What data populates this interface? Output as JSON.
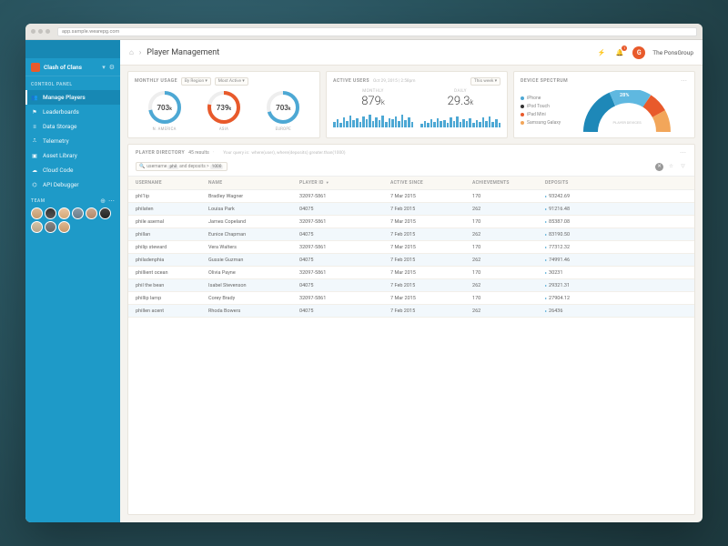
{
  "chrome": {
    "url": "app.sample.wearepg.com"
  },
  "sidebar": {
    "app_name": "Clash of Clans",
    "section_panel": "CONTROL PANEL",
    "section_team": "TEAM",
    "nav": [
      {
        "label": "Manage Players",
        "icon": "users",
        "active": true
      },
      {
        "label": "Leaderboards",
        "icon": "flag"
      },
      {
        "label": "Data Storage",
        "icon": "layers"
      },
      {
        "label": "Telemetry",
        "icon": "equalizer"
      },
      {
        "label": "Asset Library",
        "icon": "folder"
      },
      {
        "label": "Cloud Code",
        "icon": "cloud"
      },
      {
        "label": "API Debugger",
        "icon": "bug"
      }
    ]
  },
  "header": {
    "title": "Player Management",
    "user": "The PonsGroup",
    "notifications": "1"
  },
  "usage": {
    "title": "MONTHLY USAGE",
    "filter1": "By Region",
    "filter2": "Most Active",
    "donuts": [
      {
        "value": "703",
        "unit": "k",
        "label": "N. AMERICA",
        "pct": 72,
        "color": "#4da8d4"
      },
      {
        "value": "739",
        "unit": "k",
        "label": "ASIA",
        "pct": 78,
        "color": "#e85a2b"
      },
      {
        "value": "703",
        "unit": "k",
        "label": "EUROPE",
        "pct": 70,
        "color": "#4da8d4"
      }
    ]
  },
  "active": {
    "title": "ACTIVE USERS",
    "meta": "Oct 29, 2015 | 2:58pm",
    "filter": "This week",
    "metrics": [
      {
        "label": "MONTHLY",
        "value": "879",
        "unit": "k"
      },
      {
        "label": "DAILY",
        "value": "29.3",
        "unit": "k"
      }
    ],
    "bars1": [
      6,
      9,
      5,
      11,
      7,
      13,
      8,
      10,
      6,
      12,
      9,
      14,
      7,
      11,
      8,
      13,
      6,
      10,
      9,
      12,
      7,
      14,
      8,
      11,
      6
    ],
    "bars2": [
      4,
      7,
      5,
      9,
      6,
      10,
      7,
      8,
      5,
      11,
      7,
      12,
      6,
      9,
      7,
      10,
      5,
      8,
      6,
      11,
      7,
      12,
      6,
      9,
      5
    ]
  },
  "spectrum": {
    "title": "DEVICE SPECTRUM",
    "legend": [
      {
        "label": "iPhone",
        "color": "#4da8d4"
      },
      {
        "label": "iPod Touch",
        "color": "#333"
      },
      {
        "label": "iPad Mini",
        "color": "#e85a2b"
      },
      {
        "label": "Samsung Galaxy",
        "color": "#f2a65a"
      }
    ],
    "slices": [
      {
        "pct": "58%",
        "color": "#1e88b8"
      },
      {
        "pct": "28%",
        "color": "#5fb8e0"
      },
      {
        "pct": "12%",
        "color": "#e85a2b"
      },
      {
        "pct": "16%",
        "color": "#f2a65a"
      }
    ],
    "center": "PLAYER DEVICES"
  },
  "directory": {
    "title": "PLAYER DIRECTORY",
    "count": "45 results",
    "query_prefix": "Your query is:",
    "query": "where(user), where(deposits) greater.than(1000)",
    "search_prefix": "username",
    "chip1": "phil",
    "search_mid": "and deposits >",
    "chip2": "1000",
    "columns": [
      "USERNAME",
      "NAME",
      "PLAYER ID",
      "ACTIVE SINCE",
      "ACHIEVEMENTS",
      "DEPOSITS"
    ],
    "rows": [
      {
        "u": "phI1ip",
        "n": "Bradley Wagner",
        "p": "32097-5861",
        "a": "7 Mar 2015",
        "c": "170",
        "d": "93242.69"
      },
      {
        "u": "philaten",
        "n": "Louisa Park",
        "p": "04075",
        "a": "7 Feb 2015",
        "c": "262",
        "d": "91216.48"
      },
      {
        "u": "phile asernal",
        "n": "James Copeland",
        "p": "32097-5861",
        "a": "7 Mar 2015",
        "c": "170",
        "d": "85387.08"
      },
      {
        "u": "phillan",
        "n": "Eunice Chapman",
        "p": "04075",
        "a": "7 Feb 2015",
        "c": "262",
        "d": "83190.50"
      },
      {
        "u": "philip steward",
        "n": "Vera Walters",
        "p": "32097-5861",
        "a": "7 Mar 2015",
        "c": "170",
        "d": "77312.32"
      },
      {
        "u": "philadenphia",
        "n": "Gussie Guzman",
        "p": "04075",
        "a": "7 Feb 2015",
        "c": "262",
        "d": "74991.46"
      },
      {
        "u": "phillient ocean",
        "n": "Olivia Payne",
        "p": "32097-5861",
        "a": "7 Mar 2015",
        "c": "170",
        "d": "30231"
      },
      {
        "u": "phil the bean",
        "n": "Isabel Stevenson",
        "p": "04075",
        "a": "7 Feb 2015",
        "c": "262",
        "d": "29321.31"
      },
      {
        "u": "phillip lamp",
        "n": "Corey Brady",
        "p": "32097-5861",
        "a": "7 Mar 2015",
        "c": "170",
        "d": "27904.12"
      },
      {
        "u": "phillen acent",
        "n": "Rhoda Bowers",
        "p": "04075",
        "a": "7 Feb 2015",
        "c": "262",
        "d": "26436"
      }
    ]
  }
}
